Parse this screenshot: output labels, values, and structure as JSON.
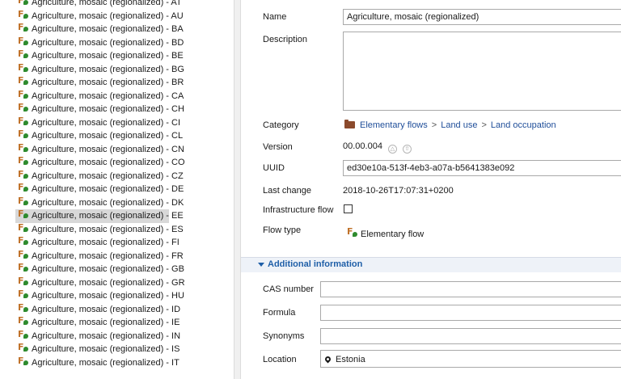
{
  "tree": {
    "item_prefix": "Agriculture, mosaic (regionalized) - ",
    "items": [
      "Agriculture, mosaic (regionalized) - AT",
      "Agriculture, mosaic (regionalized) - AU",
      "Agriculture, mosaic (regionalized) - BA",
      "Agriculture, mosaic (regionalized) - BD",
      "Agriculture, mosaic (regionalized) - BE",
      "Agriculture, mosaic (regionalized) - BG",
      "Agriculture, mosaic (regionalized) - BR",
      "Agriculture, mosaic (regionalized) - CA",
      "Agriculture, mosaic (regionalized) - CH",
      "Agriculture, mosaic (regionalized) - CI",
      "Agriculture, mosaic (regionalized) - CL",
      "Agriculture, mosaic (regionalized) - CN",
      "Agriculture, mosaic (regionalized) - CO",
      "Agriculture, mosaic (regionalized) - CZ",
      "Agriculture, mosaic (regionalized) - DE",
      "Agriculture, mosaic (regionalized) - DK",
      "Agriculture, mosaic (regionalized) - EE",
      "Agriculture, mosaic (regionalized) - ES",
      "Agriculture, mosaic (regionalized) - FI",
      "Agriculture, mosaic (regionalized) - FR",
      "Agriculture, mosaic (regionalized) - GB",
      "Agriculture, mosaic (regionalized) - GR",
      "Agriculture, mosaic (regionalized) - HU",
      "Agriculture, mosaic (regionalized) - ID",
      "Agriculture, mosaic (regionalized) - IE",
      "Agriculture, mosaic (regionalized) - IN",
      "Agriculture, mosaic (regionalized) - IS",
      "Agriculture, mosaic (regionalized) - IT"
    ],
    "selected_index": 16,
    "item_icon": "elementary-flow-icon"
  },
  "editor": {
    "labels": {
      "name": "Name",
      "description": "Description",
      "category": "Category",
      "version": "Version",
      "uuid": "UUID",
      "last_change": "Last change",
      "infrastructure_flow": "Infrastructure flow",
      "flow_type": "Flow type",
      "cas_number": "CAS number",
      "formula": "Formula",
      "synonyms": "Synonyms",
      "location": "Location"
    },
    "name_value": "Agriculture, mosaic (regionalized)",
    "description_value": "",
    "category_path": [
      "Elementary flows",
      "Land use",
      "Land occupation"
    ],
    "category_separator": ">",
    "version_value": "00.00.004",
    "uuid_value": "ed30e10a-513f-4eb3-a07a-b5641383e092",
    "last_change_value": "2018-10-26T17:07:31+0200",
    "infrastructure_flow_checked": false,
    "flow_type_value": "Elementary flow",
    "additional_info_title": "Additional information",
    "cas_number_value": "",
    "formula_value": "",
    "synonyms_value": "",
    "location_value": "Estonia"
  },
  "colors": {
    "link": "#1f4e99",
    "section_title": "#1f5fa8",
    "selection": "#d8d8d8",
    "folder": "#8b4a2c",
    "flow_leaf": "#2e8b2e",
    "flow_letter": "#c0722a"
  }
}
